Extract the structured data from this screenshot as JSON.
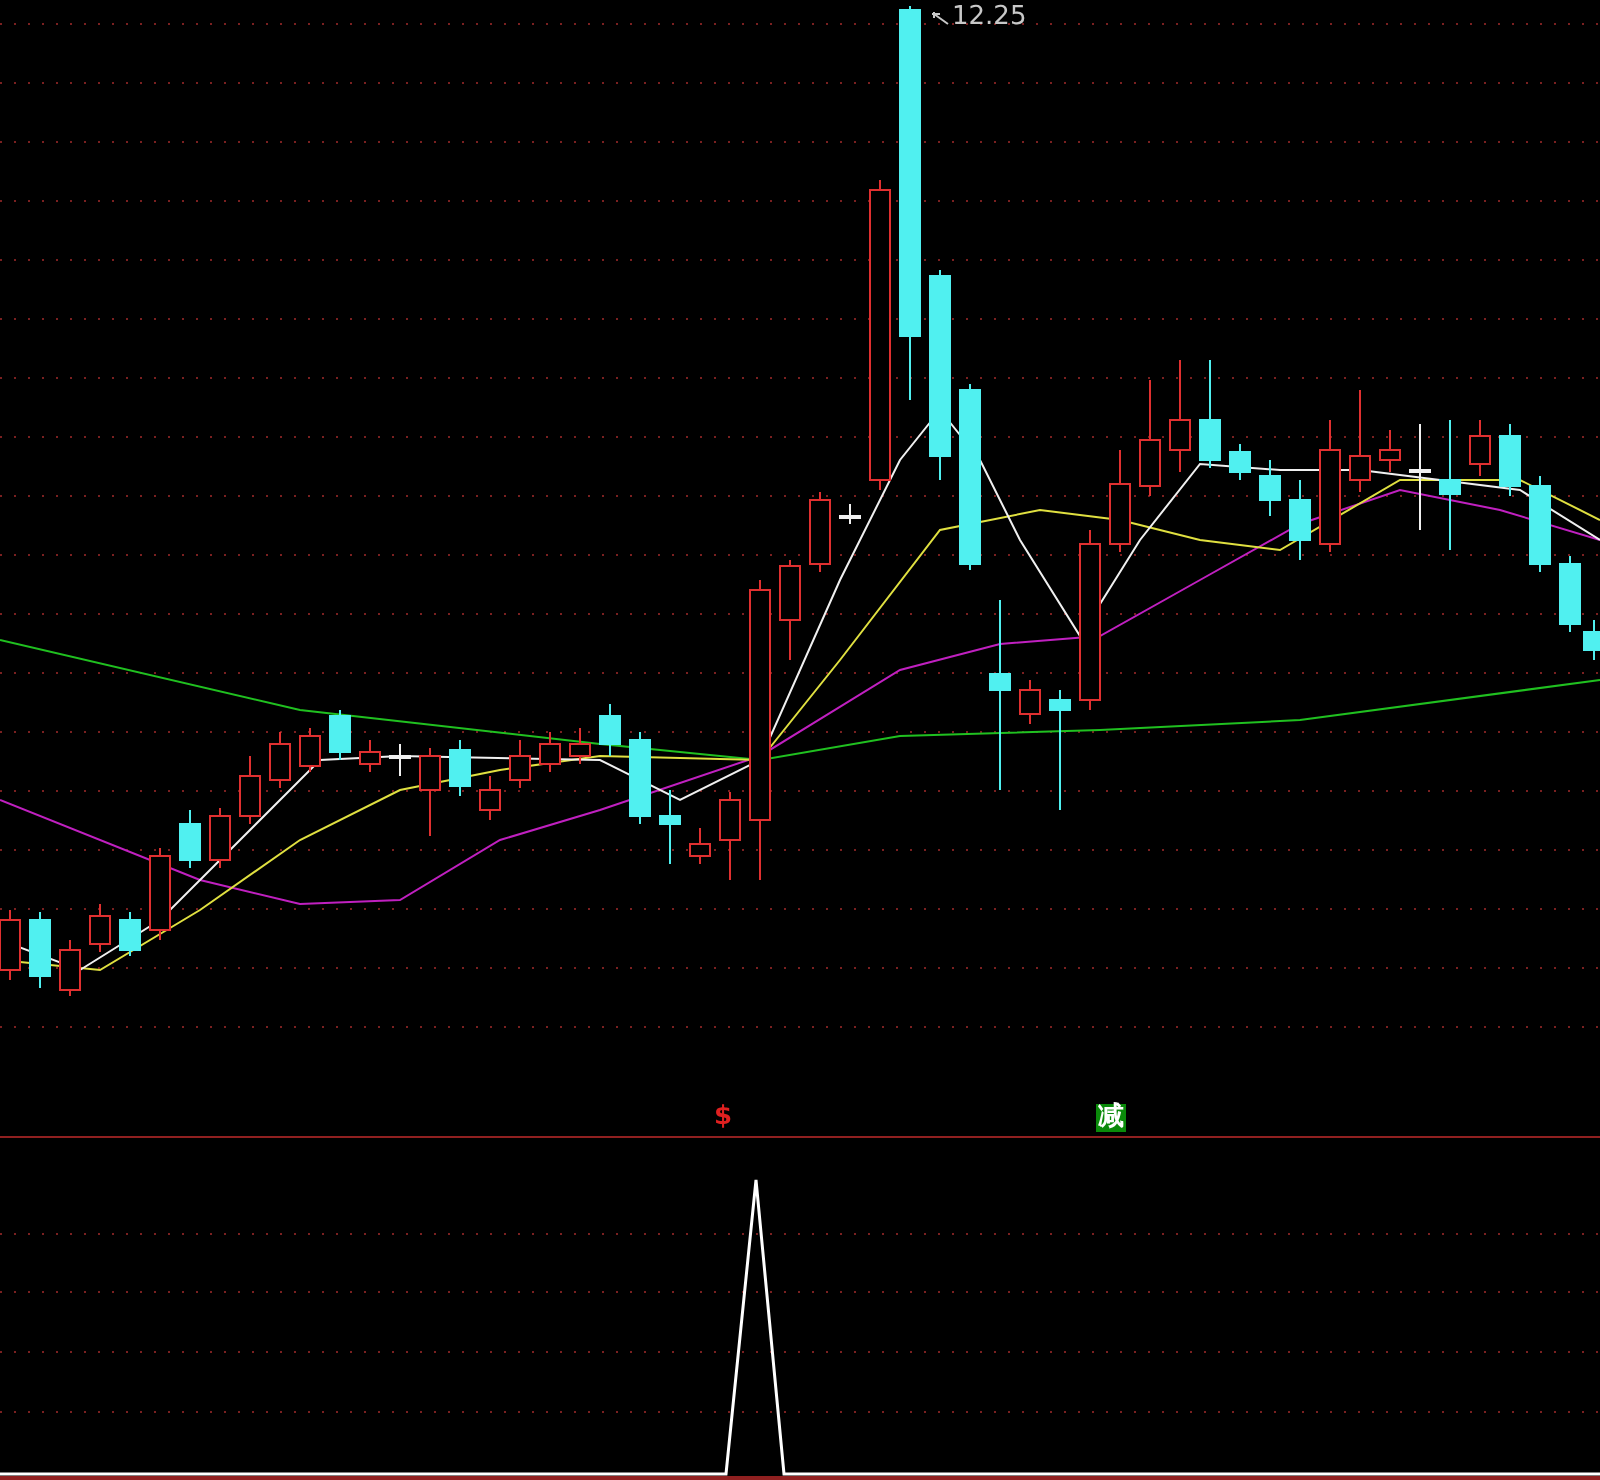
{
  "price_chart": {
    "peak_label": "12.25"
  },
  "signals": [
    {
      "kind": "buy",
      "label": "$"
    },
    {
      "kind": "sell",
      "label": "减"
    }
  ]
}
